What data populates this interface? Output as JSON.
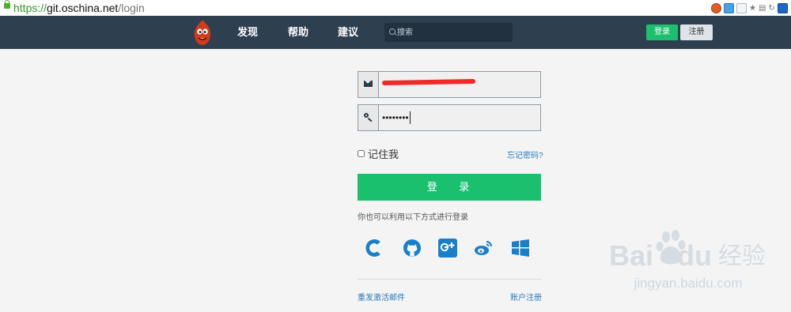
{
  "browser": {
    "url_protocol": "https://",
    "url_host": "git.oschina.net",
    "url_path": "/login",
    "tool_icons": [
      "addon-icon",
      "addon-icon",
      "addon-icon",
      "star-icon",
      "menu-icon",
      "refresh-icon",
      "paw-icon"
    ]
  },
  "navbar": {
    "logo": "oschina-mascot",
    "links": [
      "发现",
      "帮助",
      "建议"
    ],
    "search_placeholder": "搜索",
    "login_button": "登录",
    "register_button": "注册"
  },
  "form": {
    "email_value": "",
    "password_value": "••••••••",
    "remember_label": "记住我",
    "forgot_link": "忘记密码?",
    "submit_label": "登 录",
    "alt_text": "你也可以利用以下方式进行登录",
    "social_icons": [
      "csdn-icon",
      "github-icon",
      "google-plus-icon",
      "weibo-icon",
      "windows-icon"
    ],
    "resend_link": "重发激活邮件",
    "register_link": "账户注册"
  },
  "watermark": {
    "logo": "Bai du 经验",
    "url": "jingyan.baidu.com"
  },
  "colors": {
    "navbar": "#2e3f50",
    "accent_green": "#1bc06f",
    "link_blue": "#2a7ab8",
    "social_blue": "#1a7fc9"
  }
}
